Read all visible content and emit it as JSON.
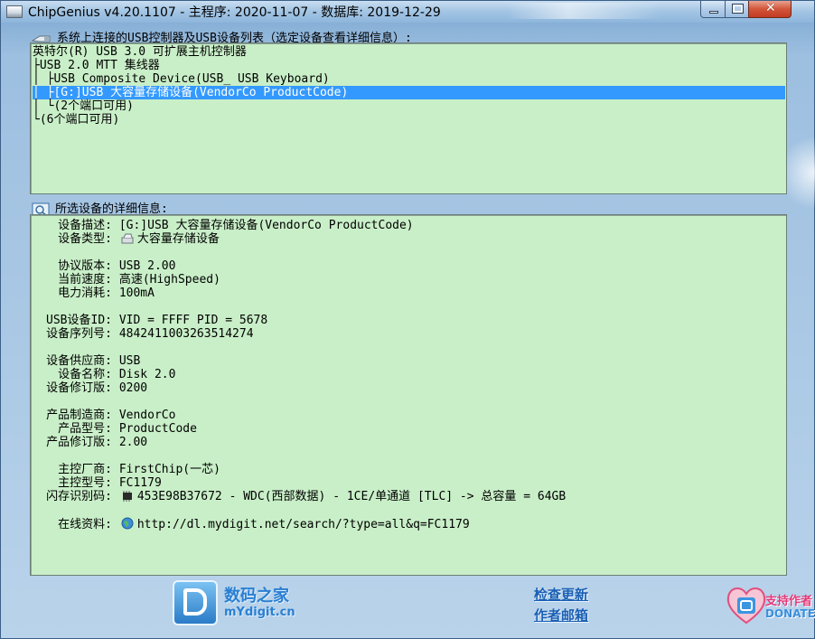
{
  "window": {
    "title": "ChipGenius v4.20.1107 - 主程序: 2020-11-07 - 数据库: 2019-12-29",
    "close_glyph": "✕",
    "icons": [
      "usb-drive-icon",
      "minimize-icon",
      "maximize-icon",
      "close-icon"
    ]
  },
  "device_list": {
    "header": "系统上连接的USB控制器及USB设备列表（选定设备查看详细信息）:",
    "lines": [
      "英特尔(R) USB 3.0 可扩展主机控制器",
      "├USB 2.0 MTT 集线器",
      "│ ├USB Composite Device(USB_ USB Keyboard)",
      "│ ├[G:]USB 大容量存储设备(VendorCo ProductCode)",
      "│ └(2个端口可用)",
      "└(6个端口可用)"
    ],
    "selected_index": 3
  },
  "details": {
    "header": "所选设备的详细信息:",
    "rows": [
      {
        "label": "设备描述:",
        "value": "[G:]USB 大容量存储设备(VendorCo ProductCode)"
      },
      {
        "label": "设备类型:",
        "value": "大容量存储设备",
        "icon": "drive-icon"
      },
      {
        "label": "协议版本:",
        "value": "USB 2.00"
      },
      {
        "label": "当前速度:",
        "value": "高速(HighSpeed)"
      },
      {
        "label": "电力消耗:",
        "value": "100mA"
      },
      {
        "label": "USB设备ID:",
        "value": "VID = FFFF PID = 5678"
      },
      {
        "label": "设备序列号:",
        "value": "4842411003263514274"
      },
      {
        "label": "设备供应商:",
        "value": "USB"
      },
      {
        "label": "设备名称:",
        "value": "Disk 2.0"
      },
      {
        "label": "设备修订版:",
        "value": "0200"
      },
      {
        "label": "产品制造商:",
        "value": "VendorCo"
      },
      {
        "label": "产品型号:",
        "value": "ProductCode"
      },
      {
        "label": "产品修订版:",
        "value": "2.00"
      },
      {
        "label": "主控厂商:",
        "value": "FirstChip(一芯)"
      },
      {
        "label": "主控型号:",
        "value": "FC1179"
      },
      {
        "label": "闪存识别码:",
        "value": "453E98B37672 - WDC(西部数据) - 1CE/单通道 [TLC] -> 总容量 = 64GB",
        "icon": "chip-icon"
      },
      {
        "label": "在线资料:",
        "value": "http://dl.mydigit.net/search/?type=all&q=FC1179",
        "icon": "globe-icon"
      }
    ]
  },
  "footer": {
    "site_name": "数码之家",
    "site_url": "mYdigit.cn",
    "check_update": "检查更新",
    "author_mail": "作者邮箱",
    "donate_line1": "支持作者",
    "donate_line2": "DONATE"
  },
  "colors": {
    "panel_bg": "#c9efc8",
    "selection": "#3399ff",
    "link": "#1a5fb4",
    "brand": "#2a7fd1"
  }
}
